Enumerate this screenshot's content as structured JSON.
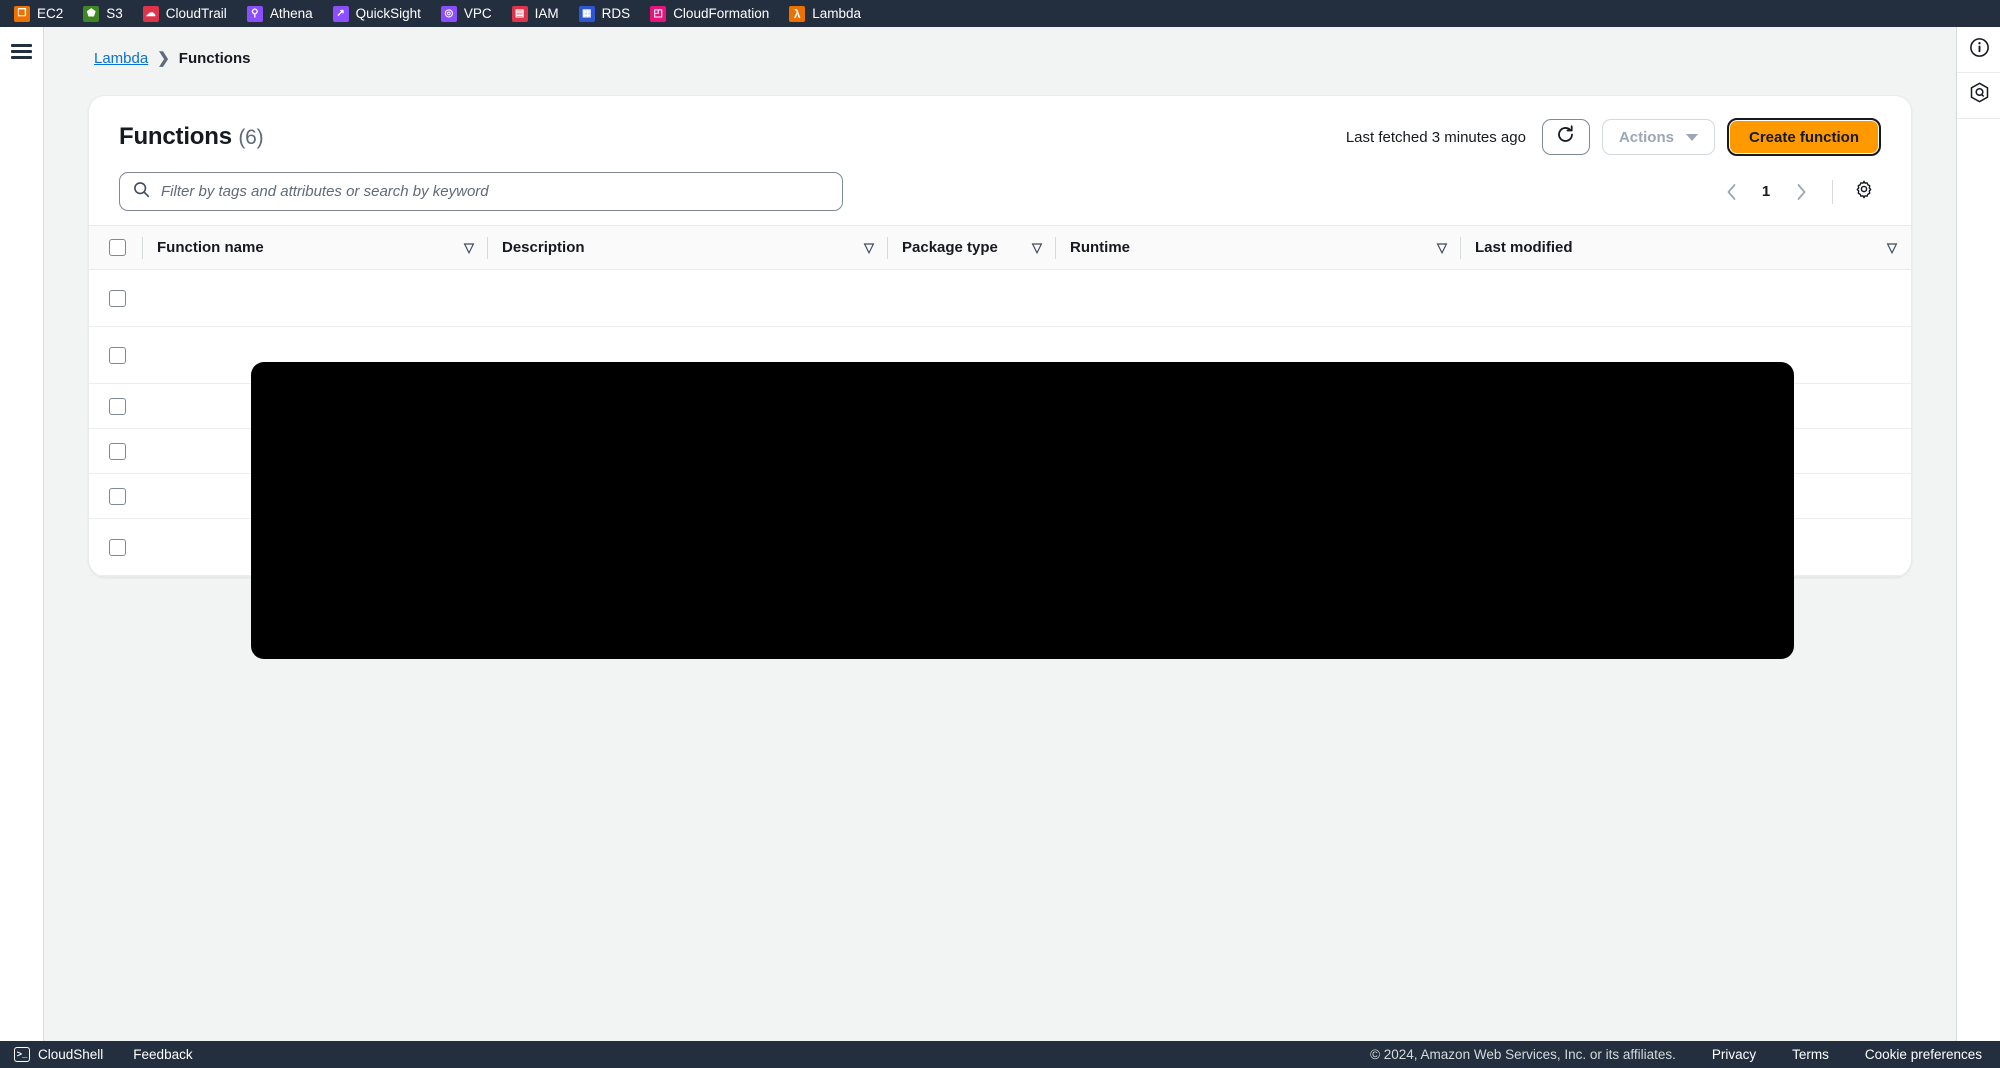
{
  "topbar": {
    "services": [
      {
        "label": "EC2",
        "icon": "ec2-icon",
        "color": "#ed7100",
        "glyph": "❐"
      },
      {
        "label": "S3",
        "icon": "s3-icon",
        "color": "#3f8624",
        "glyph": "⬟"
      },
      {
        "label": "CloudTrail",
        "icon": "cloudtrail-icon",
        "color": "#dd344c",
        "glyph": "☁"
      },
      {
        "label": "Athena",
        "icon": "athena-icon",
        "color": "#8c4fff",
        "glyph": "⚲"
      },
      {
        "label": "QuickSight",
        "icon": "quicksight-icon",
        "color": "#8c4fff",
        "glyph": "↗"
      },
      {
        "label": "VPC",
        "icon": "vpc-icon",
        "color": "#8c4fff",
        "glyph": "◎"
      },
      {
        "label": "IAM",
        "icon": "iam-icon",
        "color": "#dd344c",
        "glyph": "☰"
      },
      {
        "label": "RDS",
        "icon": "rds-icon",
        "color": "#2e55d4",
        "glyph": "▦"
      },
      {
        "label": "CloudFormation",
        "icon": "cloudformation-icon",
        "color": "#e7157b",
        "glyph": "◰"
      },
      {
        "label": "Lambda",
        "icon": "lambda-icon",
        "color": "#ed7100",
        "glyph": "λ"
      }
    ]
  },
  "breadcrumb": {
    "root": "Lambda",
    "separator": "❯",
    "current": "Functions"
  },
  "header": {
    "title": "Functions",
    "count": "(6)",
    "last_fetched": "Last fetched 3 minutes ago",
    "refresh_icon": "refresh-icon",
    "actions_label": "Actions",
    "create_label": "Create function",
    "accent_color": "#ff9900"
  },
  "search": {
    "icon": "search-icon",
    "placeholder": "Filter by tags and attributes or search by keyword",
    "value": ""
  },
  "pagination": {
    "prev": "‹",
    "page": "1",
    "next": "›",
    "settings_icon": "gear-icon"
  },
  "table": {
    "sort_glyph": "▽",
    "columns": [
      {
        "label": "Function name",
        "sortable": true
      },
      {
        "label": "Description",
        "sortable": true
      },
      {
        "label": "Package type",
        "sortable": true
      },
      {
        "label": "Runtime",
        "sortable": true
      },
      {
        "label": "Last modified",
        "sortable": true
      }
    ],
    "rows": [
      {
        "function_name": "",
        "description": "",
        "package_type": "",
        "runtime": "",
        "last_modified": ""
      },
      {
        "function_name": "",
        "description": "",
        "package_type": "",
        "runtime": "",
        "last_modified": ""
      },
      {
        "function_name": "",
        "description": "",
        "package_type": "",
        "runtime": "",
        "last_modified": ""
      },
      {
        "function_name": "",
        "description": "",
        "package_type": "",
        "runtime": "",
        "last_modified": ""
      },
      {
        "function_name": "",
        "description": "",
        "package_type": "",
        "runtime": "",
        "last_modified": ""
      },
      {
        "function_name": "",
        "description": "",
        "package_type": "",
        "runtime": "",
        "last_modified": ""
      }
    ],
    "redacted": true
  },
  "right_rail": {
    "info_icon": "info-icon",
    "assistant_icon": "aws-q-hexagon-icon"
  },
  "footer": {
    "cloudshell": "CloudShell",
    "cloudshell_icon": "cloudshell-icon",
    "cloudshell_glyph": ">_",
    "feedback": "Feedback",
    "copyright": "© 2024, Amazon Web Services, Inc. or its affiliates.",
    "privacy": "Privacy",
    "terms": "Terms",
    "cookies": "Cookie preferences"
  }
}
